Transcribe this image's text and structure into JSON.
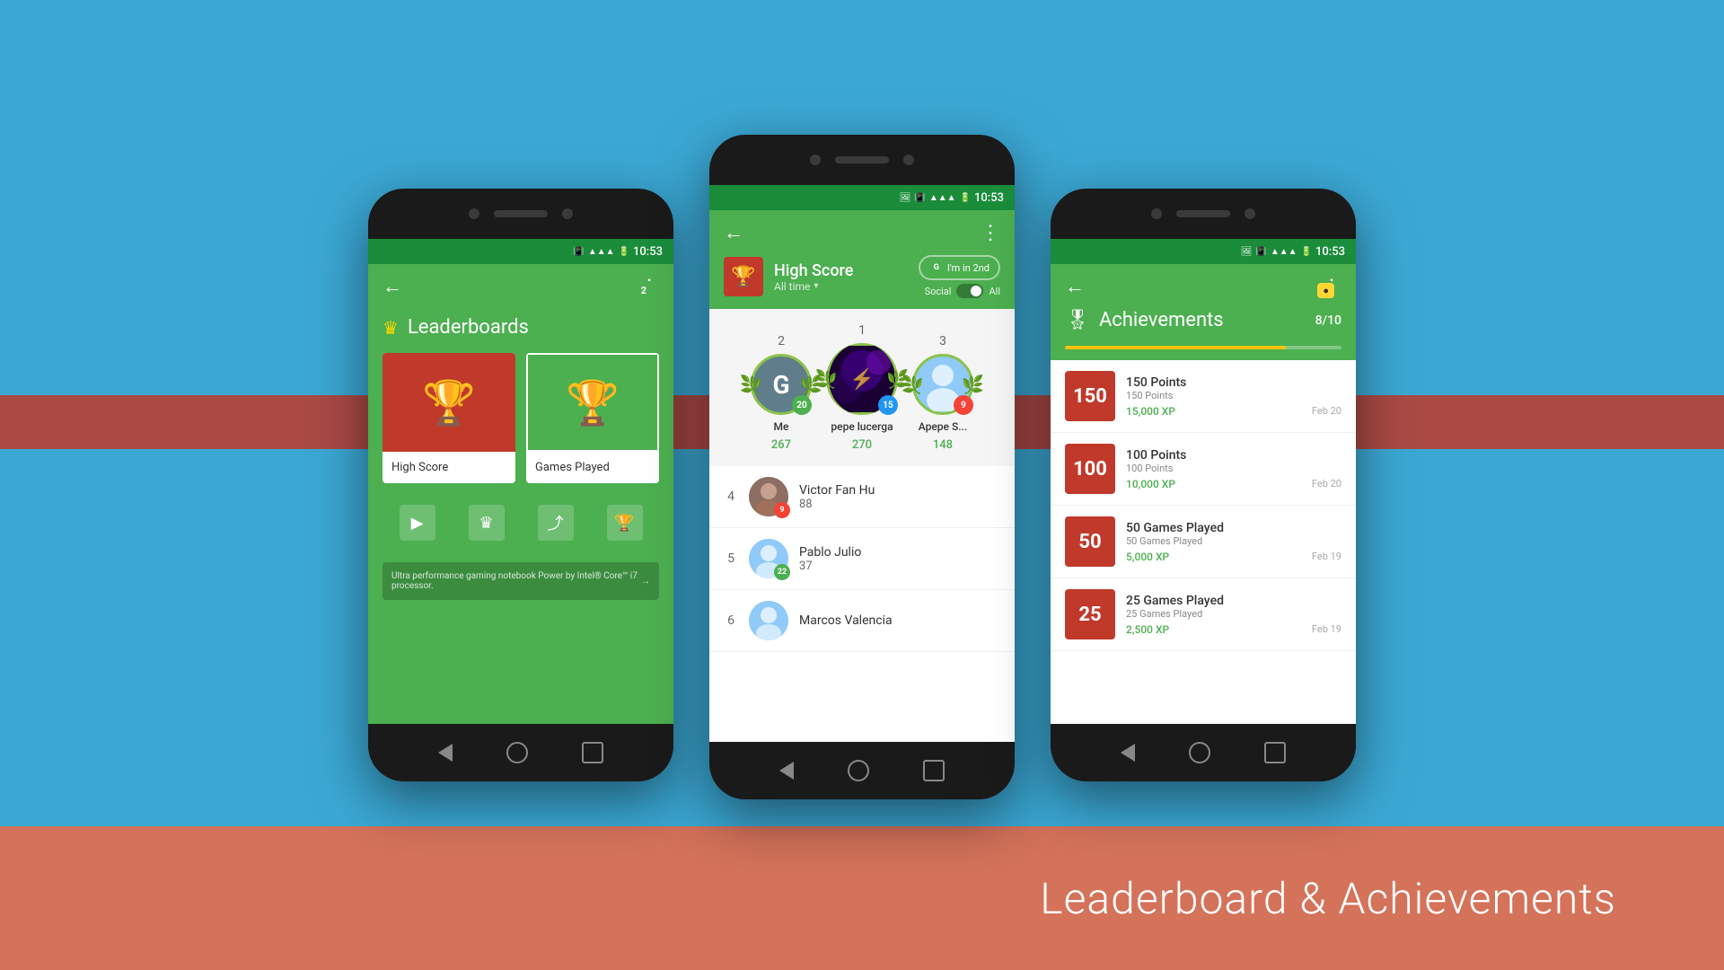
{
  "background": {
    "color": "#3ba8d4"
  },
  "bottom_banner": {
    "text": "Leaderboard & Achievements",
    "bg_color": "#d4725a"
  },
  "phone1": {
    "time": "10:53",
    "title": "Leaderboards",
    "notif_count": "2",
    "cards": [
      {
        "label": "High Score",
        "icon_type": "trophy",
        "bg": "#c0392b"
      },
      {
        "label": "Games Played",
        "icon_type": "trophy",
        "bg": "#4caf50"
      }
    ],
    "ad_text": "Ultra performance gaming notebook\nPower by Intel® Core™ i7 processor.",
    "bottom_nav": [
      "play",
      "crown",
      "share",
      "trophy"
    ]
  },
  "phone2": {
    "time": "10:53",
    "header": {
      "title": "High Score",
      "subtitle": "All time",
      "im_in_label": "I'm in 2nd",
      "social_label": "Social",
      "all_label": "All"
    },
    "podium": [
      {
        "rank": "2",
        "name": "Me",
        "score": "267",
        "avatar_text": "G",
        "avatar_class": "avatar-g",
        "badge": "20",
        "badge_color": "badge-green"
      },
      {
        "rank": "1",
        "name": "pepe lucerga",
        "score": "270",
        "avatar_text": "",
        "avatar_class": "avatar-purple",
        "badge": "15",
        "badge_color": "badge-blue"
      },
      {
        "rank": "3",
        "name": "Apepe S...",
        "score": "148",
        "avatar_text": "👤",
        "avatar_class": "avatar-blue",
        "badge": "9",
        "badge_color": "badge-red"
      }
    ],
    "list": [
      {
        "rank": "4",
        "name": "Victor Fan Hu",
        "score": "88",
        "badge": "9",
        "badge_color": "badge-red",
        "avatar_color": "#8d6e63"
      },
      {
        "rank": "5",
        "name": "Pablo Julio",
        "score": "37",
        "badge": "22",
        "badge_color": "badge-green-sm",
        "avatar_color": "#90caf9"
      },
      {
        "rank": "6",
        "name": "Marcos Valencia",
        "score": "",
        "badge": "",
        "badge_color": "",
        "avatar_color": "#90caf9"
      }
    ]
  },
  "phone3": {
    "time": "10:53",
    "title": "Achievements",
    "progress": "8/10",
    "progress_pct": 80,
    "achievements": [
      {
        "label": "150",
        "name": "150 Points",
        "desc": "150 Points",
        "xp": "15,000 XP",
        "date": "Feb 20"
      },
      {
        "label": "100",
        "name": "100 Points",
        "desc": "100 Points",
        "xp": "10,000 XP",
        "date": "Feb 20"
      },
      {
        "label": "50",
        "name": "50 Games Played",
        "desc": "50 Games Played",
        "xp": "5,000 XP",
        "date": "Feb 19"
      },
      {
        "label": "25",
        "name": "25 Games Played",
        "desc": "25 Games Played",
        "xp": "2,500 XP",
        "date": "Feb 19"
      }
    ]
  }
}
